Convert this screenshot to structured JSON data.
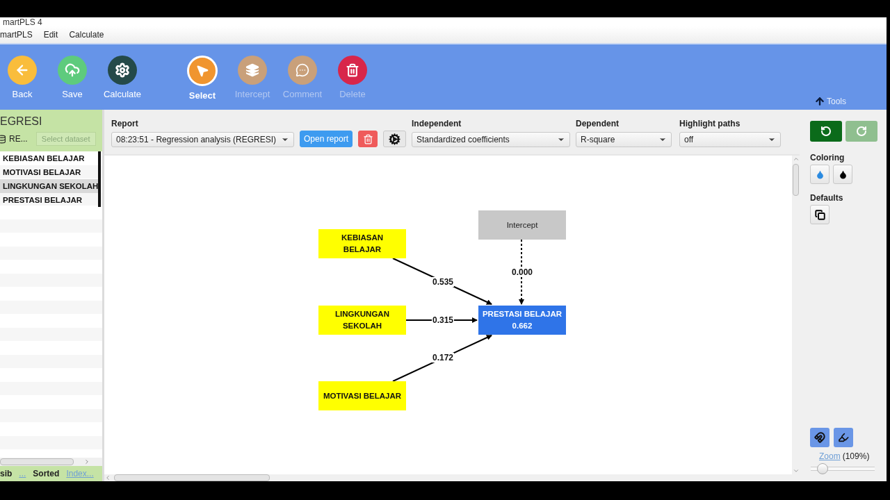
{
  "window": {
    "title": "martPLS 4"
  },
  "menu": [
    "martPLS",
    "Edit",
    "Calculate"
  ],
  "toolbar": {
    "buttons": [
      {
        "kind": "back",
        "label": "Back",
        "color": "#f9bd3c",
        "selected": false,
        "disabled": false
      },
      {
        "kind": "save",
        "label": "Save",
        "color": "#5ecb7d",
        "selected": false,
        "disabled": false
      },
      {
        "kind": "calculate",
        "label": "Calculate",
        "color": "#244a49",
        "selected": false,
        "disabled": false
      },
      {
        "kind": "select",
        "label": "Select",
        "color": "#f0952f",
        "selected": true,
        "disabled": false
      },
      {
        "kind": "intercept",
        "label": "Intercept",
        "color": "#c9a07a",
        "selected": false,
        "disabled": true
      },
      {
        "kind": "comment",
        "label": "Comment",
        "color": "#c9a07a",
        "selected": false,
        "disabled": true
      },
      {
        "kind": "delete",
        "label": "Delete",
        "color": "#d8264a",
        "selected": false,
        "disabled": true
      }
    ],
    "tools": "Tools"
  },
  "sidebar": {
    "project": "EGRESI",
    "dataset": "RE...",
    "select_dataset": "Select dataset",
    "items": [
      {
        "label": "KEBIASAN BELAJAR",
        "selected": false
      },
      {
        "label": "MOTIVASI BELAJAR",
        "selected": false
      },
      {
        "label": "LINGKUNGAN SEKOLAH",
        "selected": true
      },
      {
        "label": "PRESTASI BELAJAR",
        "selected": false
      }
    ],
    "footer": [
      {
        "label": "sib",
        "kind": "text"
      },
      {
        "label": "...",
        "kind": "link"
      },
      {
        "label": "Sorted",
        "kind": "text"
      },
      {
        "label": "Index...",
        "kind": "link"
      }
    ]
  },
  "report_bar": {
    "report": {
      "label": "Report",
      "value": "08:23:51 - Regression analysis (REGRESI)"
    },
    "buttons": [
      {
        "kind": "open",
        "label": "Open report"
      },
      {
        "kind": "delete"
      },
      {
        "kind": "settings"
      }
    ],
    "selects": [
      {
        "label": "Independent",
        "value": "Standardized coefficients"
      },
      {
        "label": "Dependent",
        "value": "R-square"
      },
      {
        "label": "Highlight paths",
        "value": "off"
      }
    ]
  },
  "diagram": {
    "nodes": [
      {
        "label": "KEBIASAN\nBELAJAR",
        "kind": "independent"
      },
      {
        "label": "LINGKUNGAN\nSEKOLAH",
        "kind": "independent"
      },
      {
        "label": "MOTIVASI BELAJAR",
        "kind": "independent"
      },
      {
        "label": "Intercept",
        "kind": "intercept"
      },
      {
        "label": "PRESTASI BELAJAR",
        "kind": "dependent",
        "value": "0.662"
      }
    ],
    "paths": [
      {
        "value": "0.535",
        "kind": "solid"
      },
      {
        "value": "0.315",
        "kind": "solid"
      },
      {
        "value": "0.172",
        "kind": "solid"
      },
      {
        "value": "0.000",
        "kind": "dashed"
      }
    ]
  },
  "tools_panel": {
    "undo": {
      "disabled": false
    },
    "redo": {
      "disabled": true
    },
    "coloring": "Coloring",
    "defaults": "Defaults",
    "zoom_link": "Zoom",
    "zoom_value": "(109%)",
    "zoom": {
      "level": 0.18
    }
  }
}
